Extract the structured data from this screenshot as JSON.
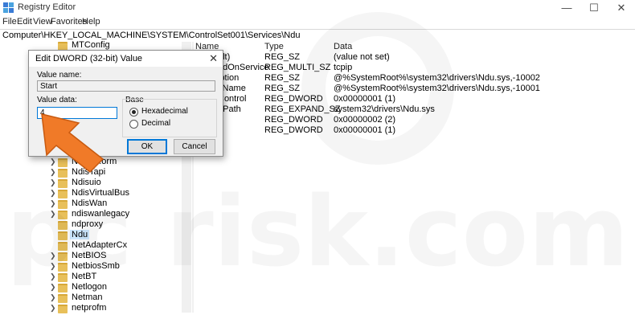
{
  "window": {
    "title": "Registry Editor",
    "controls": {
      "minimize": "—",
      "maximize": "☐",
      "close": "✕"
    }
  },
  "menu": [
    "File",
    "Edit",
    "View",
    "Favorites",
    "Help"
  ],
  "address": "Computer\\HKEY_LOCAL_MACHINE\\SYSTEM\\ControlSet001\\Services\\Ndu",
  "tree": {
    "items": [
      {
        "label": "MTConfig",
        "expandable": false,
        "selected": false
      },
      {
        "label": "Ndisu...orm",
        "expandable": true,
        "selected": false
      },
      {
        "label": "NdisTapi",
        "expandable": true,
        "selected": false
      },
      {
        "label": "Ndisuio",
        "expandable": true,
        "selected": false
      },
      {
        "label": "NdisVirtualBus",
        "expandable": true,
        "selected": false
      },
      {
        "label": "NdisWan",
        "expandable": true,
        "selected": false
      },
      {
        "label": "ndiswanlegacy",
        "expandable": true,
        "selected": false
      },
      {
        "label": "ndproxy",
        "expandable": false,
        "selected": false
      },
      {
        "label": "Ndu",
        "expandable": false,
        "selected": true
      },
      {
        "label": "NetAdapterCx",
        "expandable": false,
        "selected": false
      },
      {
        "label": "NetBIOS",
        "expandable": true,
        "selected": false
      },
      {
        "label": "NetbiosSmb",
        "expandable": true,
        "selected": false
      },
      {
        "label": "NetBT",
        "expandable": true,
        "selected": false
      },
      {
        "label": "Netlogon",
        "expandable": true,
        "selected": false
      },
      {
        "label": "Netman",
        "expandable": true,
        "selected": false
      },
      {
        "label": "netprofm",
        "expandable": true,
        "selected": false
      }
    ]
  },
  "list": {
    "headers": {
      "name": "Name",
      "type": "Type",
      "data": "Data"
    },
    "rows": [
      {
        "name": "ult)",
        "type": "REG_SZ",
        "data": "(value not set)"
      },
      {
        "name": "ndOnService",
        "type": "REG_MULTI_SZ",
        "data": "tcpip"
      },
      {
        "name": "iption",
        "type": "REG_SZ",
        "data": "@%SystemRoot%\\system32\\drivers\\Ndu.sys,-10002"
      },
      {
        "name": "yName",
        "type": "REG_SZ",
        "data": "@%SystemRoot%\\system32\\drivers\\Ndu.sys,-10001"
      },
      {
        "name": "Control",
        "type": "REG_DWORD",
        "data": "0x00000001 (1)"
      },
      {
        "name": "ePath",
        "type": "REG_EXPAND_SZ",
        "data": "system32\\drivers\\Ndu.sys"
      },
      {
        "name": "",
        "type": "REG_DWORD",
        "data": "0x00000002 (2)"
      },
      {
        "name": "",
        "type": "REG_DWORD",
        "data": "0x00000001 (1)"
      }
    ]
  },
  "dialog": {
    "title": "Edit DWORD (32-bit) Value",
    "close": "✕",
    "value_name_label": "Value name:",
    "value_name": "Start",
    "value_data_label": "Value data:",
    "value_data": "4",
    "base_label": "Base",
    "base_options": [
      "Hexadecimal",
      "Decimal"
    ],
    "base_selected": "Hexadecimal",
    "ok_label": "OK",
    "cancel_label": "Cancel"
  },
  "colors": {
    "selection": "#cce8ff",
    "arrow": "#f07a28",
    "focus_border": "#0078d7"
  },
  "watermark": "pc risk.com"
}
